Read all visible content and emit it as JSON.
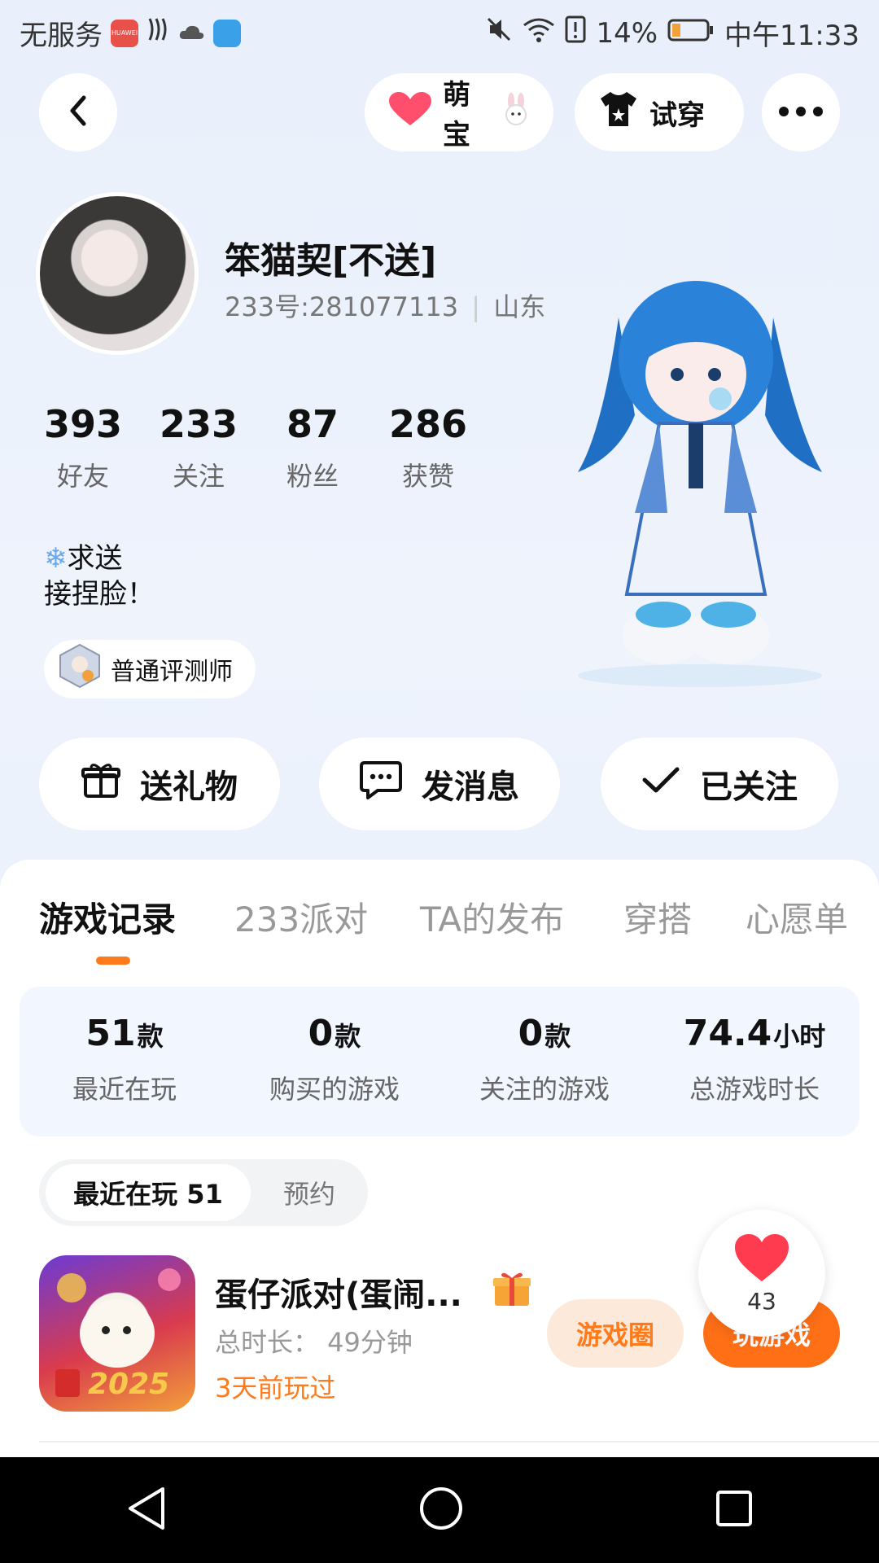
{
  "status_bar": {
    "carrier": "无服务",
    "battery": "14%",
    "time": "中午11:33",
    "huawei_label": "HUAWEI"
  },
  "top_bar": {
    "mengbao_label": "萌宝",
    "tryon_label": "试穿"
  },
  "profile": {
    "name": "笨猫契[不送]",
    "uid": "233号:281077113",
    "region": "山东",
    "stats": [
      {
        "value": "393",
        "label": "好友"
      },
      {
        "value": "233",
        "label": "关注"
      },
      {
        "value": "87",
        "label": "粉丝"
      },
      {
        "value": "286",
        "label": "获赞"
      }
    ],
    "bio_line1": "求送",
    "bio_line2": "接捏脸！",
    "badge_label": "普通评测师"
  },
  "actions": {
    "gift_label": "送礼物",
    "message_label": "发消息",
    "followed_label": "已关注"
  },
  "tabs": [
    {
      "label": "游戏记录",
      "active": true
    },
    {
      "label": "233派对",
      "active": false
    },
    {
      "label": "TA的发布",
      "active": false
    },
    {
      "label": "穿搭",
      "active": false
    },
    {
      "label": "心愿单",
      "active": false
    }
  ],
  "summary": [
    {
      "value": "51",
      "unit": "款",
      "label": "最近在玩"
    },
    {
      "value": "0",
      "unit": "款",
      "label": "购买的游戏"
    },
    {
      "value": "0",
      "unit": "款",
      "label": "关注的游戏"
    },
    {
      "value": "74.4",
      "unit": "小时",
      "label": "总游戏时长"
    }
  ],
  "segment": {
    "active_label": "最近在玩 51",
    "inactive_label": "预约"
  },
  "game": {
    "title": "蛋仔派对(蛋闹...",
    "total_time": "总时长：  49分钟",
    "last_played": "3天前玩过",
    "circle_button": "游戏圈",
    "play_button": "玩游戏",
    "icon_text": "2025"
  },
  "likes": {
    "count": "43"
  },
  "colors": {
    "accent": "#ff6f16",
    "accent_soft": "#fde9da",
    "background": "#e9f0fb"
  }
}
